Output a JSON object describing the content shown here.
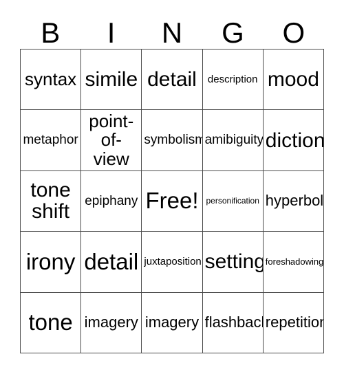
{
  "header": {
    "letters": [
      "B",
      "I",
      "N",
      "G",
      "O"
    ]
  },
  "grid": {
    "columns": 5,
    "rows": 5,
    "border_color": "#4a4a4a",
    "background_color": "#ffffff",
    "text_color": "#000000",
    "cells": [
      {
        "text": "syntax",
        "size": "lg",
        "row": 1,
        "col": 1
      },
      {
        "text": "simile",
        "size": "xl",
        "row": 1,
        "col": 2
      },
      {
        "text": "detail",
        "size": "xl",
        "row": 1,
        "col": 3
      },
      {
        "text": "description",
        "size": "xs",
        "row": 1,
        "col": 4
      },
      {
        "text": "mood",
        "size": "xl",
        "row": 1,
        "col": 5
      },
      {
        "text": "metaphor",
        "size": "sm",
        "row": 2,
        "col": 1
      },
      {
        "text": "point-of-view",
        "size": "lg",
        "row": 2,
        "col": 2
      },
      {
        "text": "symbolism",
        "size": "sm",
        "row": 2,
        "col": 3
      },
      {
        "text": "amibiguity",
        "size": "sm",
        "row": 2,
        "col": 4
      },
      {
        "text": "diction",
        "size": "xl",
        "row": 2,
        "col": 5
      },
      {
        "text": "tone shift",
        "size": "xl",
        "row": 3,
        "col": 1
      },
      {
        "text": "epiphany",
        "size": "sm",
        "row": 3,
        "col": 2
      },
      {
        "text": "Free!",
        "size": "xxl",
        "row": 3,
        "col": 3
      },
      {
        "text": "personification",
        "size": "tiny",
        "row": 3,
        "col": 4
      },
      {
        "text": "hyperbole",
        "size": "md",
        "row": 3,
        "col": 5
      },
      {
        "text": "irony",
        "size": "xxl",
        "row": 4,
        "col": 1
      },
      {
        "text": "detail",
        "size": "xxl",
        "row": 4,
        "col": 2
      },
      {
        "text": "juxtaposition",
        "size": "xs",
        "row": 4,
        "col": 3
      },
      {
        "text": "setting",
        "size": "xl",
        "row": 4,
        "col": 4
      },
      {
        "text": "foreshadowing",
        "size": "xxs",
        "row": 4,
        "col": 5
      },
      {
        "text": "tone",
        "size": "xxl",
        "row": 5,
        "col": 1
      },
      {
        "text": "imagery",
        "size": "md",
        "row": 5,
        "col": 2
      },
      {
        "text": "imagery",
        "size": "md",
        "row": 5,
        "col": 3
      },
      {
        "text": "flashback",
        "size": "md",
        "row": 5,
        "col": 4
      },
      {
        "text": "repetition",
        "size": "md",
        "row": 5,
        "col": 5
      }
    ]
  }
}
